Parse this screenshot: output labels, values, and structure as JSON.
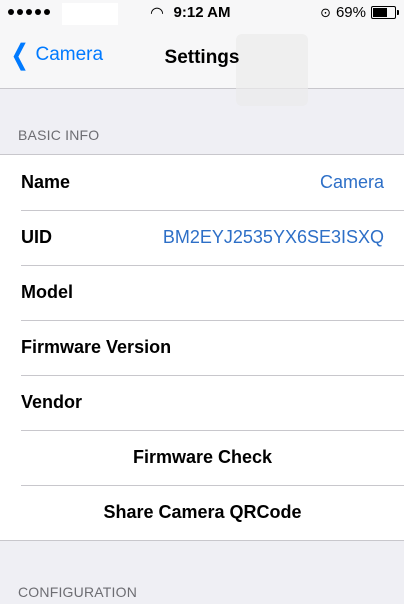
{
  "status_bar": {
    "signal_dots": 5,
    "time": "9:12 AM",
    "battery_percent": "69%",
    "battery_level": 0.69,
    "wifi_icon": "wifi-icon",
    "lock_icon": "rotation-lock-icon"
  },
  "nav": {
    "back_label": "Camera",
    "title": "Settings"
  },
  "basic_info": {
    "header": "BASIC INFO",
    "rows": [
      {
        "label": "Name",
        "value": "Camera"
      },
      {
        "label": "UID",
        "value": "BM2EYJ2535YX6SE3ISXQ"
      },
      {
        "label": "Model",
        "value": ""
      },
      {
        "label": "Firmware Version",
        "value": ""
      },
      {
        "label": "Vendor",
        "value": ""
      }
    ],
    "actions": [
      {
        "label": "Firmware Check"
      },
      {
        "label": "Share Camera QRCode"
      }
    ]
  },
  "configuration": {
    "header": "CONFIGURATION"
  },
  "colors": {
    "accent": "#007aff",
    "value_text": "#2d6fc7",
    "background": "#efeff4"
  }
}
